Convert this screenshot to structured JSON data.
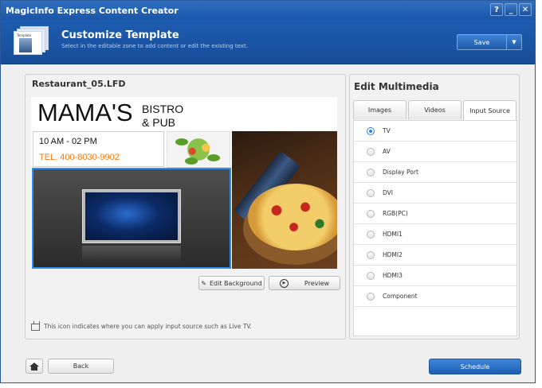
{
  "window": {
    "title": "MagicInfo Express Content Creator",
    "controls": {
      "help": "?",
      "minimize": "_",
      "close": "✕"
    }
  },
  "header": {
    "title": "Customize Template",
    "subtitle": "Select in the editable zone to add content or edit the existing text.",
    "thumbnail_label": "Template",
    "save_label": "Save",
    "save_arrow": "▼"
  },
  "template": {
    "file_name": "Restaurant_05.LFD",
    "headline": "MAMA'S",
    "subhead_line1": "BISTRO",
    "subhead_line2": "& PUB",
    "hours": "10 AM - 02 PM",
    "phone": "TEL. 400-8030-9902",
    "edit_background_label": "Edit Background",
    "preview_label": "Preview",
    "note": "This icon indicates where you can apply input source such as Live TV."
  },
  "multimedia": {
    "title": "Edit Multimedia",
    "tabs": [
      {
        "label": "Images"
      },
      {
        "label": "Videos"
      },
      {
        "label": "Input Source"
      }
    ],
    "active_tab": "Input Source",
    "sources": [
      {
        "label": "TV",
        "selected": true
      },
      {
        "label": "AV",
        "selected": false
      },
      {
        "label": "Display Port",
        "selected": false
      },
      {
        "label": "DVI",
        "selected": false
      },
      {
        "label": "RGB(PC)",
        "selected": false
      },
      {
        "label": "HDMI1",
        "selected": false
      },
      {
        "label": "HDMI2",
        "selected": false
      },
      {
        "label": "HDMI3",
        "selected": false
      },
      {
        "label": "Component",
        "selected": false
      }
    ]
  },
  "footer": {
    "back_label": "Back",
    "schedule_label": "Schedule"
  },
  "colors": {
    "titlebar": "#1b56a8",
    "accent": "#2b8ff0",
    "phone_text": "#f07c1a"
  }
}
